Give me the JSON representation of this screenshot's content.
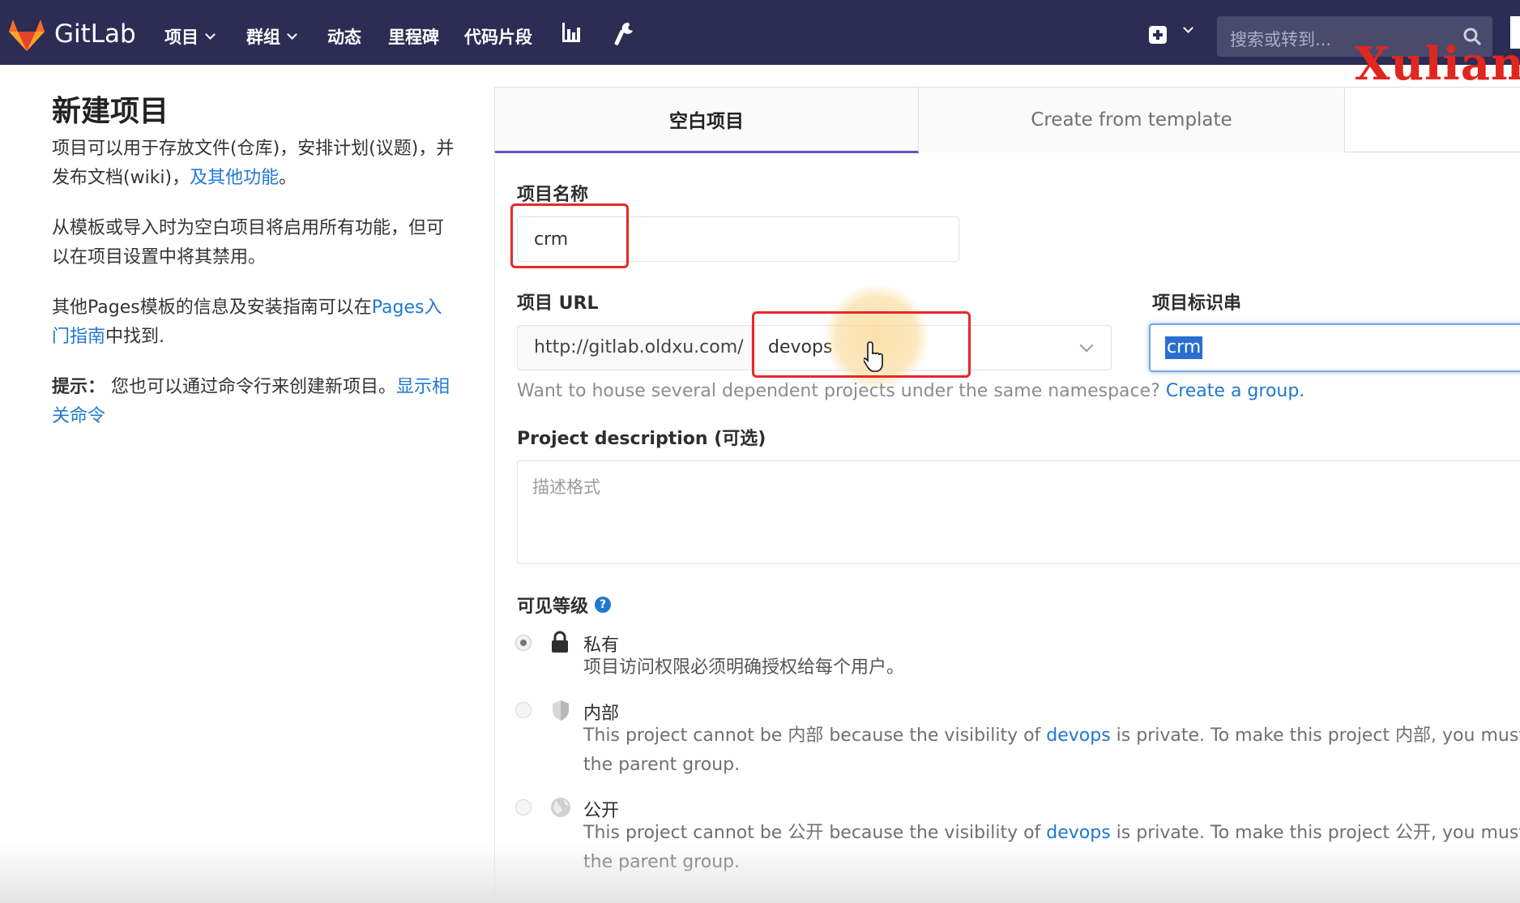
{
  "nav": {
    "brand": "GitLab",
    "items": [
      {
        "label": "项目",
        "has_dropdown": true
      },
      {
        "label": "群组",
        "has_dropdown": true
      },
      {
        "label": "动态",
        "has_dropdown": false
      },
      {
        "label": "里程碑",
        "has_dropdown": false
      },
      {
        "label": "代码片段",
        "has_dropdown": false
      }
    ],
    "icons": [
      "chart-icon",
      "wrench-icon",
      "plus-square-icon"
    ],
    "search_placeholder": "搜索或转到...",
    "bg_color": "#2c2c55"
  },
  "watermark": "Xuliang",
  "sidebar": {
    "title": "新建项目",
    "p1_text": "项目可以用于存放文件(仓库)，安排计划(议题)，并发布文档(wiki)，",
    "p1_link": "及其他功能",
    "p1_end": "。",
    "p2_text": "从模板或导入时为空白项目将启用所有功能，但可以在项目设置中将其禁用。",
    "p3_text": "其他Pages模板的信息及安装指南可以在",
    "p3_link": "Pages入门指南",
    "p3_end": "中找到.",
    "tip_bold": "提示：",
    "tip_text": " 您也可以通过命令行来创建新项目。",
    "tip_link": "显示相关命令"
  },
  "tabs": [
    {
      "label": "空白项目",
      "active": true
    },
    {
      "label": "Create from template",
      "active": false
    }
  ],
  "form": {
    "name_label": "项目名称",
    "name_value": "crm",
    "url_label": "项目 URL",
    "url_prefix": "http://gitlab.oldxu.com/",
    "namespace_value": "devops",
    "slug_label": "项目标识串",
    "slug_value": "crm",
    "help_text": "Want to house several dependent projects under the same namespace? ",
    "help_link": "Create a group.",
    "desc_label": "Project description (可选)",
    "desc_placeholder": "描述格式"
  },
  "visibility": {
    "label": "可见等级",
    "options": [
      {
        "title": "私有",
        "desc": "项目访问权限必须明确授权给每个用户。",
        "checked": true,
        "icon": "lock-icon"
      },
      {
        "title": "内部",
        "desc_a": "This project cannot be 内部 because the visibility of ",
        "desc_link": "devops",
        "desc_b": " is private. To make this project 内部, you must firs",
        "desc_c": "the parent group.",
        "checked": false,
        "icon": "shield-icon"
      },
      {
        "title": "公开",
        "desc_a": "This project cannot be 公开 because the visibility of ",
        "desc_link": "devops",
        "desc_b": " is private. To make this project 公开, you must firs",
        "desc_c": "the parent group.",
        "checked": false,
        "icon": "globe-icon"
      }
    ]
  },
  "colors": {
    "accent": "#6b4fbb",
    "link": "#1f78d1",
    "highlight": "#e8282b"
  }
}
